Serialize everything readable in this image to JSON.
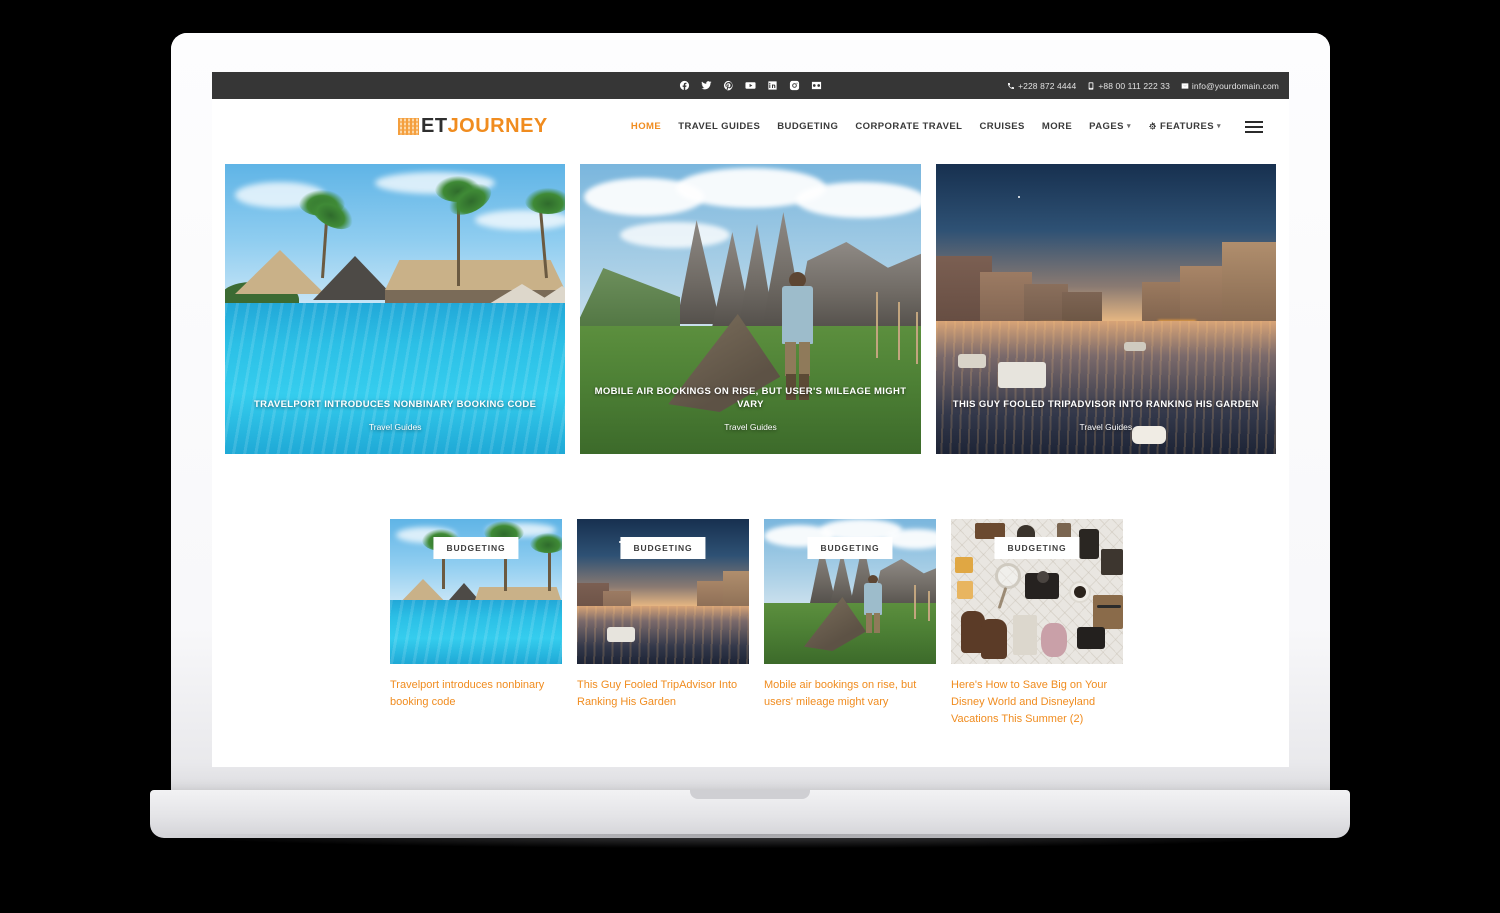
{
  "topbar": {
    "social": [
      {
        "name": "facebook-icon",
        "label": "Facebook"
      },
      {
        "name": "twitter-icon",
        "label": "Twitter"
      },
      {
        "name": "pinterest-icon",
        "label": "Pinterest"
      },
      {
        "name": "youtube-icon",
        "label": "YouTube"
      },
      {
        "name": "linkedin-icon",
        "label": "LinkedIn"
      },
      {
        "name": "instagram-icon",
        "label": "Instagram"
      },
      {
        "name": "flickr-icon",
        "label": "Flickr"
      }
    ],
    "contacts": [
      {
        "icon": "phone-icon",
        "text": "+228 872 4444"
      },
      {
        "icon": "mobile-icon",
        "text": "+88 00 111 222 33"
      },
      {
        "icon": "envelope-icon",
        "text": "info@yourdomain.com"
      }
    ]
  },
  "header": {
    "logo": {
      "mark": "et-logo-mark",
      "text_dark": "ET",
      "text_accent": "JOURNEY"
    },
    "nav": [
      {
        "label": "HOME",
        "active": true,
        "caret": false,
        "icon": null
      },
      {
        "label": "TRAVEL GUIDES",
        "active": false,
        "caret": false,
        "icon": null
      },
      {
        "label": "BUDGETING",
        "active": false,
        "caret": false,
        "icon": null
      },
      {
        "label": "CORPORATE TRAVEL",
        "active": false,
        "caret": false,
        "icon": null
      },
      {
        "label": "CRUISES",
        "active": false,
        "caret": false,
        "icon": null
      },
      {
        "label": "MORE",
        "active": false,
        "caret": false,
        "icon": null
      },
      {
        "label": "PAGES",
        "active": false,
        "caret": true,
        "icon": null
      },
      {
        "label": "FEATURES",
        "active": false,
        "caret": true,
        "icon": "gear-icon"
      }
    ],
    "menu_toggle": "hamburger-icon"
  },
  "hero": {
    "slides": [
      {
        "title": "TRAVELPORT INTRODUCES NONBINARY BOOKING CODE",
        "category": "Travel Guides",
        "scene": "tropical-resort-pool"
      },
      {
        "title": "MOBILE AIR BOOKINGS ON RISE, BUT USER'S MILEAGE MIGHT VARY",
        "category": "Travel Guides",
        "scene": "dolomites-hiker"
      },
      {
        "title": "THIS GUY FOOLED TRIPADVISOR INTO RANKING HIS GARDEN",
        "category": "Travel Guides",
        "scene": "venice-canal-dusk"
      }
    ]
  },
  "cards": [
    {
      "badge": "BUDGETING",
      "title": "Travelport introduces nonbinary booking code",
      "scene": "tropical-resort-pool"
    },
    {
      "badge": "BUDGETING",
      "title": "This Guy Fooled TripAdvisor Into Ranking His Garden",
      "scene": "venice-canal-dusk"
    },
    {
      "badge": "BUDGETING",
      "title": "Mobile air bookings on rise, but users' mileage might vary",
      "scene": "dolomites-hiker"
    },
    {
      "badge": "BUDGETING",
      "title": "Here's How to Save Big on Your Disney World and Disneyland Vacations This Summer (2)",
      "scene": "travel-flatlay"
    }
  ],
  "colors": {
    "accent": "#f08c1f",
    "topbar_bg": "#363636",
    "page_bg": "#ffffff",
    "nav_text": "#3a3a3a",
    "device_body": "#f2f2f4"
  }
}
